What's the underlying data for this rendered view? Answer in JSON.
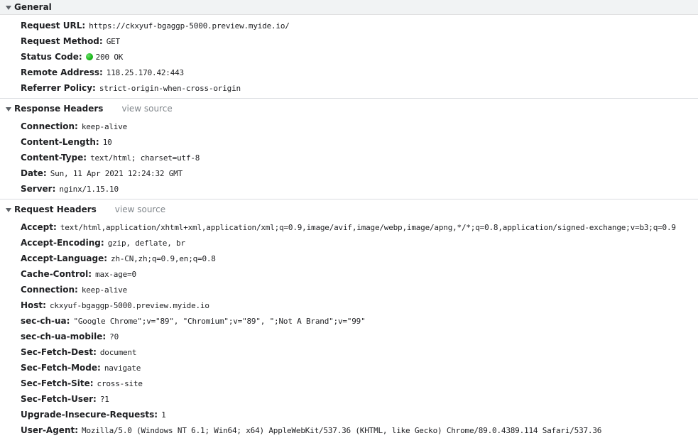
{
  "general": {
    "title": "General",
    "rows": [
      {
        "key": "Request URL:",
        "value": "https://ckxyuf-bgaggp-5000.preview.myide.io/"
      },
      {
        "key": "Request Method:",
        "value": "GET"
      },
      {
        "key": "Status Code:",
        "value": "200 OK",
        "status_color": "#1db91d"
      },
      {
        "key": "Remote Address:",
        "value": "118.25.170.42:443"
      },
      {
        "key": "Referrer Policy:",
        "value": "strict-origin-when-cross-origin"
      }
    ]
  },
  "response_headers": {
    "title": "Response Headers",
    "view_source": "view source",
    "rows": [
      {
        "key": "Connection:",
        "value": "keep-alive"
      },
      {
        "key": "Content-Length:",
        "value": "10"
      },
      {
        "key": "Content-Type:",
        "value": "text/html; charset=utf-8"
      },
      {
        "key": "Date:",
        "value": "Sun, 11 Apr 2021 12:24:32 GMT"
      },
      {
        "key": "Server:",
        "value": "nginx/1.15.10"
      }
    ]
  },
  "request_headers": {
    "title": "Request Headers",
    "view_source": "view source",
    "rows": [
      {
        "key": "Accept:",
        "value": "text/html,application/xhtml+xml,application/xml;q=0.9,image/avif,image/webp,image/apng,*/*;q=0.8,application/signed-exchange;v=b3;q=0.9"
      },
      {
        "key": "Accept-Encoding:",
        "value": "gzip, deflate, br"
      },
      {
        "key": "Accept-Language:",
        "value": "zh-CN,zh;q=0.9,en;q=0.8"
      },
      {
        "key": "Cache-Control:",
        "value": "max-age=0"
      },
      {
        "key": "Connection:",
        "value": "keep-alive"
      },
      {
        "key": "Host:",
        "value": "ckxyuf-bgaggp-5000.preview.myide.io"
      },
      {
        "key": "sec-ch-ua:",
        "value": "\"Google Chrome\";v=\"89\", \"Chromium\";v=\"89\", \";Not A Brand\";v=\"99\""
      },
      {
        "key": "sec-ch-ua-mobile:",
        "value": "?0"
      },
      {
        "key": "Sec-Fetch-Dest:",
        "value": "document"
      },
      {
        "key": "Sec-Fetch-Mode:",
        "value": "navigate"
      },
      {
        "key": "Sec-Fetch-Site:",
        "value": "cross-site"
      },
      {
        "key": "Sec-Fetch-User:",
        "value": "?1"
      },
      {
        "key": "Upgrade-Insecure-Requests:",
        "value": "1"
      },
      {
        "key": "User-Agent:",
        "value": "Mozilla/5.0 (Windows NT 6.1; Win64; x64) AppleWebKit/537.36 (KHTML, like Gecko) Chrome/89.0.4389.114 Safari/537.36"
      }
    ]
  }
}
